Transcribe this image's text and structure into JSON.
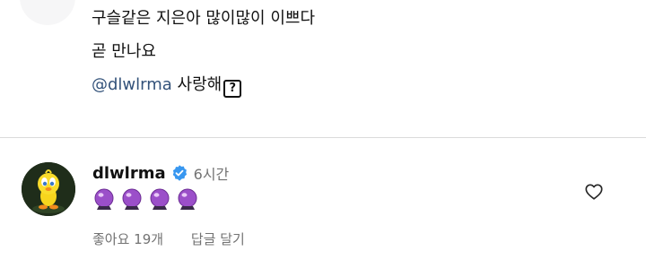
{
  "comment": {
    "lines": [
      "구슬같은 지은아 많이많이 이쁘다",
      "곧 만나요"
    ],
    "mention": "@dlwlrma",
    "after_mention": " 사랑해",
    "unknown_glyph": "?"
  },
  "reply": {
    "username": "dlwlrma",
    "time": "6시간",
    "emoji": [
      "crystal-ball",
      "crystal-ball",
      "crystal-ball",
      "crystal-ball"
    ],
    "likes": "좋아요 19개",
    "reply_link": "답글 달기",
    "verified_color": "#3897f0"
  },
  "colors": {
    "mention": "#33527a",
    "secondary_text": "#737373",
    "divider": "#dbdbdb"
  }
}
